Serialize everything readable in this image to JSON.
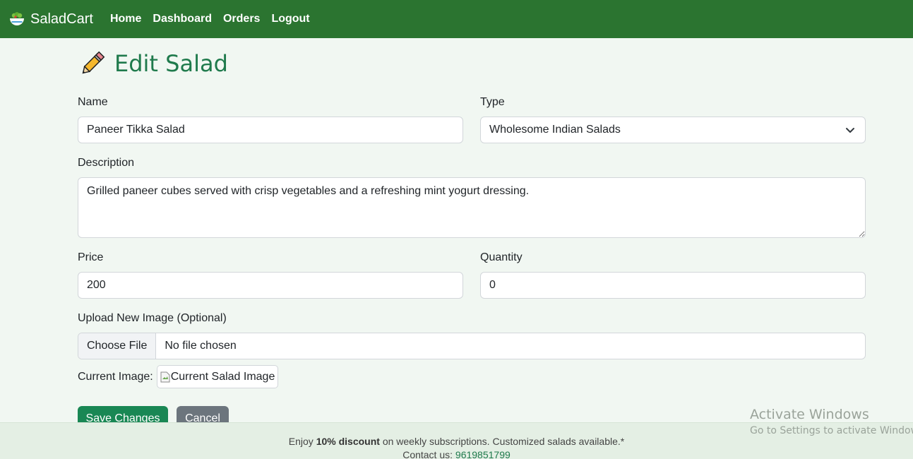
{
  "navbar": {
    "brand": "SaladCart",
    "links": [
      "Home",
      "Dashboard",
      "Orders",
      "Logout"
    ],
    "bg_color": "#2b7430"
  },
  "page": {
    "title": "Edit Salad",
    "title_icon": "pencil-icon"
  },
  "form": {
    "name_label": "Name",
    "name_value": "Paneer Tikka Salad",
    "type_label": "Type",
    "type_value": "Wholesome Indian Salads",
    "description_label": "Description",
    "description_value": "Grilled paneer cubes served with crisp vegetables and a refreshing mint yogurt dressing.",
    "price_label": "Price",
    "price_value": "200",
    "quantity_label": "Quantity",
    "quantity_value": "0",
    "upload_label": "Upload New Image (Optional)",
    "choose_file_label": "Choose File",
    "file_status": "No file chosen",
    "current_image_label": "Current Image:",
    "current_image_alt": "Current Salad Image",
    "save_label": "Save Changes",
    "cancel_label": "Cancel",
    "save_color": "#198754",
    "cancel_color": "#6c757d"
  },
  "footer": {
    "text_before": "Enjoy ",
    "discount": "10% discount",
    "text_after": " on weekly subscriptions. Customized salads available.*",
    "contact_label": "Contact us: ",
    "phone": "9619851799"
  },
  "watermark": {
    "title": "Activate Windows",
    "subtitle": "Go to Settings to activate Windows."
  }
}
